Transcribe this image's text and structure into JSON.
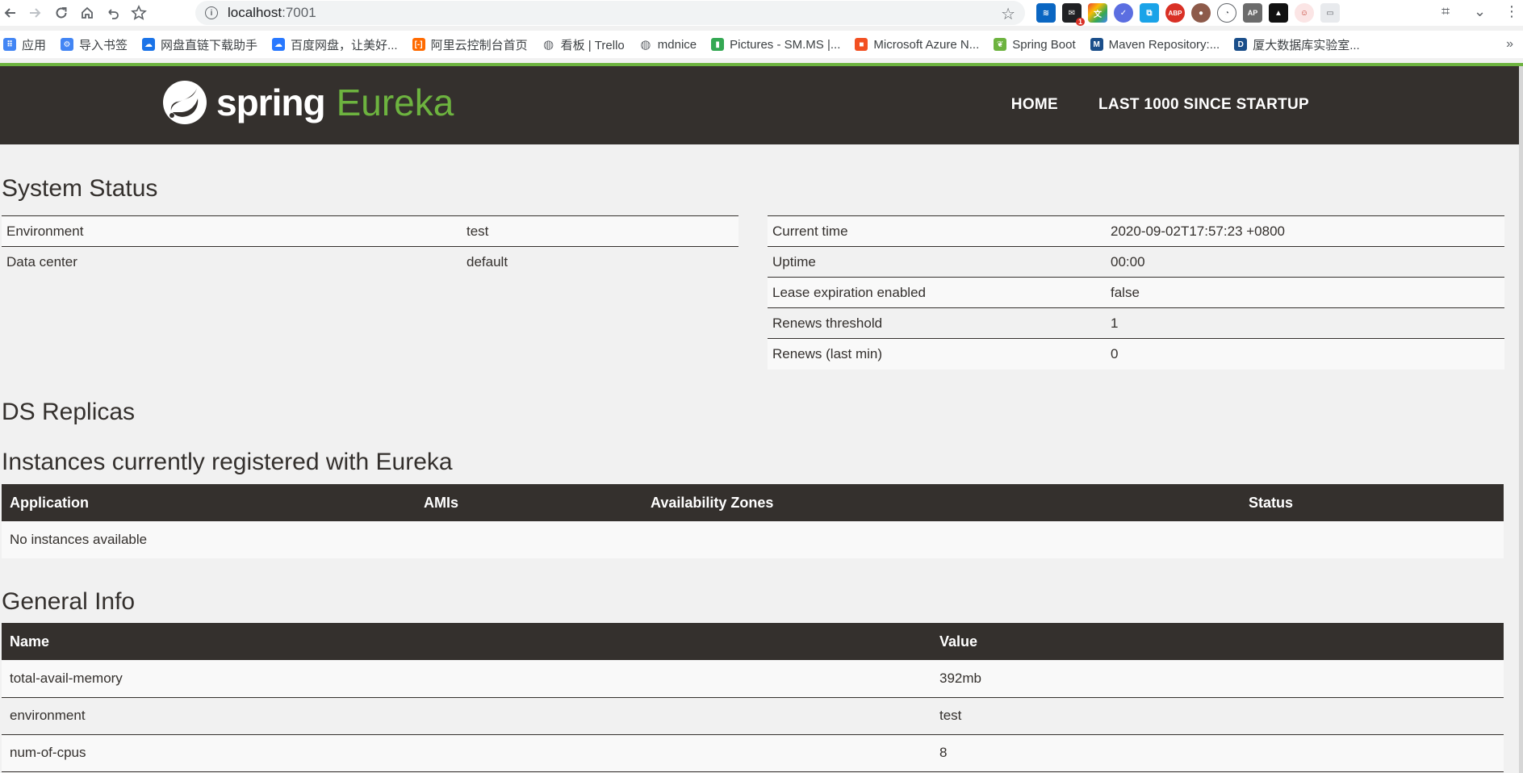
{
  "browser": {
    "url_host": "localhost",
    "url_port": ":7001",
    "extension_badge": "1",
    "bookmarks": [
      {
        "label": "应用",
        "icon": "apps-grid-icon",
        "color": "#4285f4"
      },
      {
        "label": "导入书签",
        "icon": "gear-icon",
        "color": "#4285f4"
      },
      {
        "label": "网盘直链下载助手",
        "icon": "cloud-icon",
        "color": "#1a73e8"
      },
      {
        "label": "百度网盘，让美好...",
        "icon": "baidu-cloud-icon",
        "color": "#2878ff"
      },
      {
        "label": "阿里云控制台首页",
        "icon": "aliyun-icon",
        "color": "#ff6a00"
      },
      {
        "label": "看板 | Trello",
        "icon": "globe-icon",
        "color": "#5f6368"
      },
      {
        "label": "mdnice",
        "icon": "globe-icon",
        "color": "#5f6368"
      },
      {
        "label": "Pictures - SM.MS |...",
        "icon": "bar-chart-icon",
        "color": "#34a853"
      },
      {
        "label": "Microsoft Azure N...",
        "icon": "windows-logo-icon",
        "color": "#f25022"
      },
      {
        "label": "Spring Boot",
        "icon": "spring-leaf-icon",
        "color": "#6db33f"
      },
      {
        "label": "Maven Repository:...",
        "icon": "mvn-icon",
        "color": "#1a4e8a"
      },
      {
        "label": "厦大数据库实验室...",
        "icon": "dblab-icon",
        "color": "#1a4e8a"
      }
    ]
  },
  "header": {
    "logo_word": "spring",
    "logo_product": "Eureka",
    "nav": [
      "HOME",
      "LAST 1000 SINCE STARTUP"
    ]
  },
  "system_status": {
    "title": "System Status",
    "left": [
      {
        "k": "Environment",
        "v": "test"
      },
      {
        "k": "Data center",
        "v": "default"
      }
    ],
    "right": [
      {
        "k": "Current time",
        "v": "2020-09-02T17:57:23 +0800"
      },
      {
        "k": "Uptime",
        "v": "00:00"
      },
      {
        "k": "Lease expiration enabled",
        "v": "false"
      },
      {
        "k": "Renews threshold",
        "v": "1"
      },
      {
        "k": "Renews (last min)",
        "v": "0"
      }
    ]
  },
  "ds_replicas": {
    "title": "DS Replicas"
  },
  "instances": {
    "title": "Instances currently registered with Eureka",
    "columns": [
      "Application",
      "AMIs",
      "Availability Zones",
      "Status"
    ],
    "empty_text": "No instances available"
  },
  "general_info": {
    "title": "General Info",
    "columns": [
      "Name",
      "Value"
    ],
    "rows": [
      {
        "name": "total-avail-memory",
        "value": "392mb"
      },
      {
        "name": "environment",
        "value": "test"
      },
      {
        "name": "num-of-cpus",
        "value": "8"
      }
    ]
  }
}
